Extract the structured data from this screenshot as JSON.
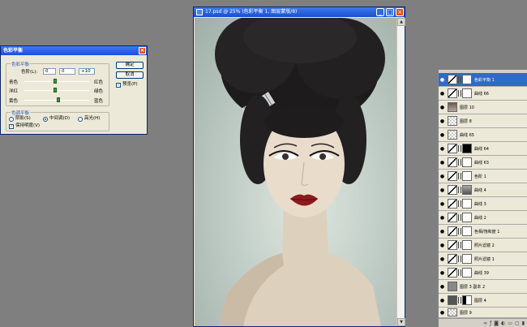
{
  "dialog": {
    "title": "色彩平衡",
    "balance_group": "色彩平衡",
    "levels_label": "色阶(L):",
    "levels": [
      "0",
      "0",
      "+10"
    ],
    "slider1": {
      "left": "青色",
      "right": "红色",
      "position": 0.5
    },
    "slider2": {
      "left": "洋红",
      "right": "绿色",
      "position": 0.5
    },
    "slider3": {
      "left": "黄色",
      "right": "蓝色",
      "position": 0.55
    },
    "tone_group": "色调平衡",
    "tone_options": [
      "阴影(S)",
      "中间调(D)",
      "高光(H)"
    ],
    "tone_selected": "中间调(D)",
    "preserve_luminosity": "保持明度(V)",
    "ok_label": "确定",
    "cancel_label": "取消",
    "preview_label": "预览(P)"
  },
  "document": {
    "title": "17.psd @ 25% (色彩平衡 1, 图层蒙版/8)"
  },
  "layers": [
    {
      "name": "色彩平衡 1",
      "selected": true,
      "thumb": "adj",
      "mask": "white"
    },
    {
      "name": "曲线 66",
      "thumb": "adj",
      "mask": "white"
    },
    {
      "name": "图层 10",
      "thumb": "photo",
      "mask": ""
    },
    {
      "name": "图层 8",
      "thumb": "check",
      "mask": ""
    },
    {
      "name": "曲线 65",
      "thumb": "check",
      "mask": ""
    },
    {
      "name": "曲线 64",
      "thumb": "adj",
      "mask": "black"
    },
    {
      "name": "曲线 63",
      "thumb": "adj",
      "mask": "white"
    },
    {
      "name": "色阶 1",
      "thumb": "adj",
      "mask": "white"
    },
    {
      "name": "曲线 4",
      "thumb": "adj",
      "mask": "person"
    },
    {
      "name": "曲线 3",
      "thumb": "adj",
      "mask": "white"
    },
    {
      "name": "曲线 2",
      "thumb": "adj",
      "mask": "white"
    },
    {
      "name": "色相/饱和度 1",
      "thumb": "adj",
      "mask": "white"
    },
    {
      "name": "照片滤镜 2",
      "thumb": "adj",
      "mask": "white"
    },
    {
      "name": "照片滤镜 1",
      "thumb": "adj",
      "mask": "white"
    },
    {
      "name": "曲线 39",
      "thumb": "adj",
      "mask": "white"
    },
    {
      "name": "图层 3 副本 2",
      "thumb": "gray",
      "mask": ""
    },
    {
      "name": "图层 4",
      "thumb": "gray2",
      "mask": "dark"
    },
    {
      "name": "图层 9",
      "thumb": "check",
      "mask": ""
    }
  ]
}
